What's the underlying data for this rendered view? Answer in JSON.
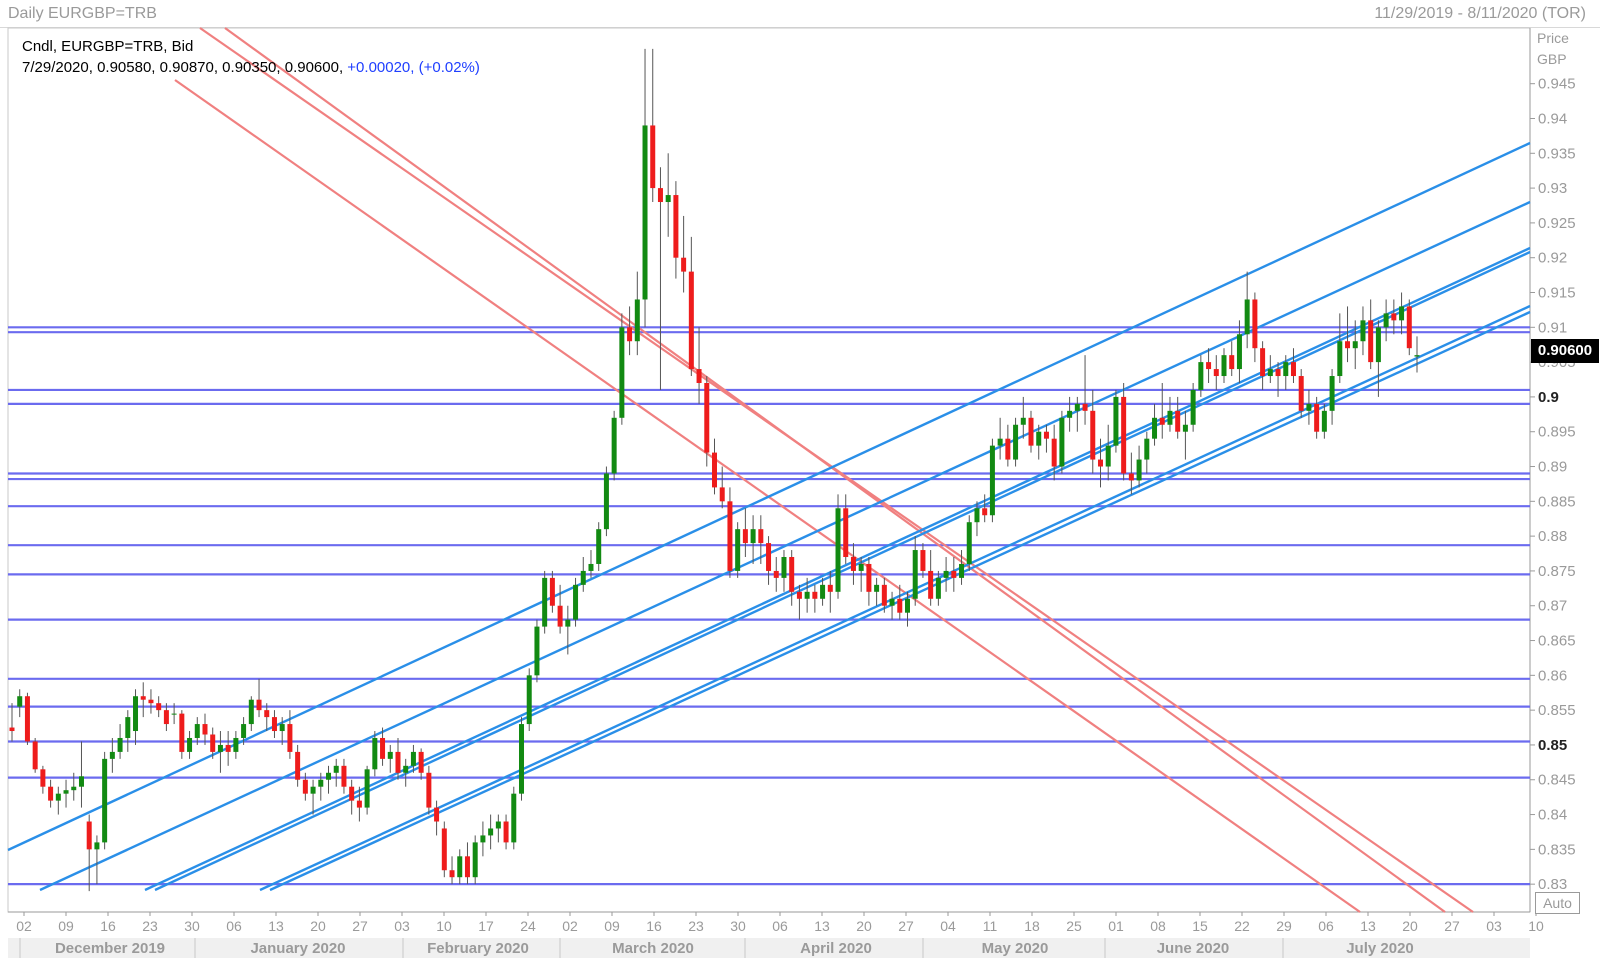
{
  "window": {
    "title": "Daily EURGBP=TRB",
    "date_range": "11/29/2019 - 8/11/2020 (TOR)"
  },
  "info": {
    "line1": "Cndl, EURGBP=TRB, Bid",
    "ohlc": "7/29/2020, 0.90580, 0.90870, 0.90350, 0.90600,",
    "change": "+0.00020, (+0.02%)"
  },
  "axis": {
    "price_label": "Price",
    "currency_label": "GBP",
    "current_price": "0.90600",
    "auto_label": "Auto"
  },
  "colors": {
    "up": "#128a12",
    "down": "#ee1c1c",
    "h_line": "#6b6bef",
    "channel": "#2a8fe8",
    "downtrend": "#f08080",
    "grid": "#b8b8b8"
  },
  "chart_data": {
    "type": "candlestick",
    "symbol": "EURGBP=TRB",
    "ylim": [
      0.826,
      0.953
    ],
    "y_ticks": [
      "0.83",
      "0.835",
      "0.84",
      "0.845",
      "0.85",
      "0.855",
      "0.86",
      "0.865",
      "0.87",
      "0.875",
      "0.88",
      "0.885",
      "0.89",
      "0.895",
      "0.9",
      "0.905",
      "0.91",
      "0.915",
      "0.92",
      "0.925",
      "0.93",
      "0.935",
      "0.94",
      "0.945"
    ],
    "x_ticks": [
      "02",
      "09",
      "16",
      "23",
      "30",
      "06",
      "13",
      "20",
      "27",
      "03",
      "10",
      "17",
      "24",
      "02",
      "09",
      "16",
      "23",
      "30",
      "06",
      "13",
      "20",
      "27",
      "04",
      "11",
      "18",
      "25",
      "01",
      "08",
      "15",
      "22",
      "29",
      "06",
      "13",
      "20",
      "27",
      "03",
      "10"
    ],
    "months": [
      "December 2019",
      "January 2020",
      "February 2020",
      "March 2020",
      "April 2020",
      "May 2020",
      "June 2020",
      "July 2020"
    ],
    "horizontal_levels": [
      0.91,
      0.9093,
      0.901,
      0.899,
      0.889,
      0.8882,
      0.8843,
      0.8787,
      0.8745,
      0.868,
      0.8595,
      0.8555,
      0.8505,
      0.8453,
      0.83
    ],
    "candles": [
      [
        0.8525,
        0.856,
        0.8505,
        0.852
      ],
      [
        0.8555,
        0.858,
        0.854,
        0.857
      ],
      [
        0.857,
        0.8575,
        0.85,
        0.8505
      ],
      [
        0.8505,
        0.851,
        0.846,
        0.8465
      ],
      [
        0.8465,
        0.847,
        0.843,
        0.844
      ],
      [
        0.844,
        0.845,
        0.841,
        0.842
      ],
      [
        0.842,
        0.844,
        0.84,
        0.843
      ],
      [
        0.843,
        0.845,
        0.841,
        0.8435
      ],
      [
        0.8435,
        0.846,
        0.842,
        0.844
      ],
      [
        0.844,
        0.8505,
        0.841,
        0.8455
      ],
      [
        0.839,
        0.84,
        0.829,
        0.835
      ],
      [
        0.835,
        0.837,
        0.83,
        0.836
      ],
      [
        0.836,
        0.849,
        0.835,
        0.848
      ],
      [
        0.848,
        0.851,
        0.846,
        0.849
      ],
      [
        0.849,
        0.853,
        0.848,
        0.851
      ],
      [
        0.851,
        0.855,
        0.849,
        0.854
      ],
      [
        0.852,
        0.858,
        0.85,
        0.857
      ],
      [
        0.857,
        0.859,
        0.854,
        0.8565
      ],
      [
        0.8565,
        0.858,
        0.8545,
        0.856
      ],
      [
        0.856,
        0.857,
        0.854,
        0.855
      ],
      [
        0.855,
        0.856,
        0.852,
        0.853
      ],
      [
        0.8545,
        0.856,
        0.853,
        0.8545
      ],
      [
        0.8545,
        0.855,
        0.848,
        0.849
      ],
      [
        0.849,
        0.852,
        0.848,
        0.851
      ],
      [
        0.851,
        0.854,
        0.85,
        0.853
      ],
      [
        0.853,
        0.8545,
        0.85,
        0.8515
      ],
      [
        0.8515,
        0.8525,
        0.848,
        0.849
      ],
      [
        0.849,
        0.852,
        0.846,
        0.85
      ],
      [
        0.85,
        0.852,
        0.847,
        0.849
      ],
      [
        0.849,
        0.852,
        0.848,
        0.851
      ],
      [
        0.851,
        0.854,
        0.85,
        0.853
      ],
      [
        0.853,
        0.857,
        0.852,
        0.8565
      ],
      [
        0.8565,
        0.8595,
        0.854,
        0.855
      ],
      [
        0.855,
        0.856,
        0.852,
        0.854
      ],
      [
        0.854,
        0.855,
        0.851,
        0.852
      ],
      [
        0.852,
        0.854,
        0.85,
        0.853
      ],
      [
        0.853,
        0.855,
        0.848,
        0.849
      ],
      [
        0.849,
        0.85,
        0.844,
        0.845
      ],
      [
        0.845,
        0.846,
        0.842,
        0.843
      ],
      [
        0.843,
        0.845,
        0.84,
        0.844
      ],
      [
        0.844,
        0.846,
        0.842,
        0.845
      ],
      [
        0.845,
        0.847,
        0.843,
        0.846
      ],
      [
        0.846,
        0.848,
        0.844,
        0.847
      ],
      [
        0.847,
        0.848,
        0.843,
        0.844
      ],
      [
        0.844,
        0.845,
        0.84,
        0.842
      ],
      [
        0.842,
        0.844,
        0.839,
        0.841
      ],
      [
        0.841,
        0.847,
        0.84,
        0.8465
      ],
      [
        0.8465,
        0.852,
        0.8455,
        0.851
      ],
      [
        0.851,
        0.8525,
        0.847,
        0.848
      ],
      [
        0.848,
        0.85,
        0.846,
        0.849
      ],
      [
        0.849,
        0.851,
        0.845,
        0.846
      ],
      [
        0.846,
        0.848,
        0.844,
        0.847
      ],
      [
        0.847,
        0.85,
        0.846,
        0.849
      ],
      [
        0.849,
        0.8495,
        0.845,
        0.846
      ],
      [
        0.846,
        0.847,
        0.84,
        0.841
      ],
      [
        0.841,
        0.842,
        0.837,
        0.839
      ],
      [
        0.838,
        0.839,
        0.831,
        0.832
      ],
      [
        0.832,
        0.834,
        0.83,
        0.831
      ],
      [
        0.831,
        0.835,
        0.83,
        0.834
      ],
      [
        0.834,
        0.836,
        0.83,
        0.831
      ],
      [
        0.831,
        0.837,
        0.83,
        0.836
      ],
      [
        0.836,
        0.839,
        0.834,
        0.837
      ],
      [
        0.837,
        0.84,
        0.835,
        0.838
      ],
      [
        0.838,
        0.84,
        0.836,
        0.839
      ],
      [
        0.839,
        0.84,
        0.835,
        0.836
      ],
      [
        0.836,
        0.844,
        0.835,
        0.843
      ],
      [
        0.843,
        0.854,
        0.842,
        0.853
      ],
      [
        0.853,
        0.861,
        0.852,
        0.86
      ],
      [
        0.86,
        0.868,
        0.859,
        0.867
      ],
      [
        0.867,
        0.875,
        0.866,
        0.874
      ],
      [
        0.874,
        0.875,
        0.869,
        0.87
      ],
      [
        0.87,
        0.873,
        0.866,
        0.867
      ],
      [
        0.867,
        0.87,
        0.863,
        0.868
      ],
      [
        0.868,
        0.874,
        0.867,
        0.873
      ],
      [
        0.873,
        0.877,
        0.872,
        0.875
      ],
      [
        0.875,
        0.878,
        0.874,
        0.876
      ],
      [
        0.876,
        0.882,
        0.875,
        0.881
      ],
      [
        0.881,
        0.89,
        0.88,
        0.889
      ],
      [
        0.889,
        0.898,
        0.888,
        0.897
      ],
      [
        0.897,
        0.912,
        0.896,
        0.91
      ],
      [
        0.91,
        0.913,
        0.906,
        0.908
      ],
      [
        0.908,
        0.918,
        0.906,
        0.914
      ],
      [
        0.914,
        0.95,
        0.91,
        0.939
      ],
      [
        0.939,
        0.95,
        0.928,
        0.93
      ],
      [
        0.93,
        0.933,
        0.901,
        0.928
      ],
      [
        0.928,
        0.935,
        0.923,
        0.929
      ],
      [
        0.929,
        0.931,
        0.917,
        0.92
      ],
      [
        0.92,
        0.926,
        0.915,
        0.918
      ],
      [
        0.918,
        0.923,
        0.903,
        0.904
      ],
      [
        0.904,
        0.91,
        0.899,
        0.902
      ],
      [
        0.902,
        0.903,
        0.89,
        0.892
      ],
      [
        0.892,
        0.894,
        0.886,
        0.887
      ],
      [
        0.887,
        0.89,
        0.884,
        0.885
      ],
      [
        0.885,
        0.887,
        0.874,
        0.875
      ],
      [
        0.875,
        0.882,
        0.874,
        0.881
      ],
      [
        0.881,
        0.884,
        0.877,
        0.879
      ],
      [
        0.879,
        0.883,
        0.876,
        0.881
      ],
      [
        0.881,
        0.883,
        0.876,
        0.879
      ],
      [
        0.879,
        0.88,
        0.873,
        0.875
      ],
      [
        0.875,
        0.877,
        0.872,
        0.874
      ],
      [
        0.874,
        0.878,
        0.872,
        0.877
      ],
      [
        0.877,
        0.878,
        0.87,
        0.872
      ],
      [
        0.872,
        0.873,
        0.868,
        0.871
      ],
      [
        0.871,
        0.874,
        0.869,
        0.872
      ],
      [
        0.872,
        0.873,
        0.869,
        0.871
      ],
      [
        0.871,
        0.874,
        0.87,
        0.873
      ],
      [
        0.873,
        0.875,
        0.869,
        0.872
      ],
      [
        0.872,
        0.886,
        0.871,
        0.884
      ],
      [
        0.884,
        0.886,
        0.876,
        0.877
      ],
      [
        0.877,
        0.879,
        0.873,
        0.875
      ],
      [
        0.875,
        0.877,
        0.872,
        0.876
      ],
      [
        0.876,
        0.877,
        0.87,
        0.872
      ],
      [
        0.872,
        0.874,
        0.87,
        0.873
      ],
      [
        0.873,
        0.874,
        0.869,
        0.87
      ],
      [
        0.87,
        0.872,
        0.868,
        0.871
      ],
      [
        0.871,
        0.873,
        0.868,
        0.869
      ],
      [
        0.869,
        0.872,
        0.867,
        0.871
      ],
      [
        0.871,
        0.88,
        0.87,
        0.878
      ],
      [
        0.878,
        0.879,
        0.874,
        0.875
      ],
      [
        0.875,
        0.878,
        0.87,
        0.871
      ],
      [
        0.871,
        0.875,
        0.87,
        0.874
      ],
      [
        0.874,
        0.877,
        0.872,
        0.875
      ],
      [
        0.875,
        0.877,
        0.872,
        0.874
      ],
      [
        0.874,
        0.878,
        0.873,
        0.876
      ],
      [
        0.876,
        0.883,
        0.875,
        0.882
      ],
      [
        0.882,
        0.885,
        0.88,
        0.884
      ],
      [
        0.884,
        0.886,
        0.882,
        0.883
      ],
      [
        0.883,
        0.894,
        0.882,
        0.893
      ],
      [
        0.893,
        0.897,
        0.891,
        0.894
      ],
      [
        0.894,
        0.896,
        0.89,
        0.891
      ],
      [
        0.891,
        0.897,
        0.89,
        0.896
      ],
      [
        0.896,
        0.9,
        0.894,
        0.897
      ],
      [
        0.897,
        0.898,
        0.892,
        0.893
      ],
      [
        0.893,
        0.896,
        0.891,
        0.895
      ],
      [
        0.895,
        0.896,
        0.892,
        0.894
      ],
      [
        0.894,
        0.896,
        0.888,
        0.89
      ],
      [
        0.89,
        0.898,
        0.889,
        0.897
      ],
      [
        0.897,
        0.9,
        0.895,
        0.898
      ],
      [
        0.898,
        0.9,
        0.895,
        0.899
      ],
      [
        0.899,
        0.906,
        0.896,
        0.898
      ],
      [
        0.898,
        0.901,
        0.889,
        0.891
      ],
      [
        0.891,
        0.894,
        0.887,
        0.89
      ],
      [
        0.89,
        0.896,
        0.888,
        0.893
      ],
      [
        0.893,
        0.901,
        0.892,
        0.9
      ],
      [
        0.9,
        0.902,
        0.888,
        0.889
      ],
      [
        0.889,
        0.892,
        0.886,
        0.888
      ],
      [
        0.888,
        0.893,
        0.887,
        0.891
      ],
      [
        0.891,
        0.895,
        0.889,
        0.894
      ],
      [
        0.894,
        0.899,
        0.893,
        0.897
      ],
      [
        0.897,
        0.902,
        0.894,
        0.896
      ],
      [
        0.896,
        0.9,
        0.895,
        0.898
      ],
      [
        0.898,
        0.9,
        0.894,
        0.895
      ],
      [
        0.895,
        0.898,
        0.891,
        0.896
      ],
      [
        0.896,
        0.902,
        0.895,
        0.901
      ],
      [
        0.901,
        0.906,
        0.9,
        0.905
      ],
      [
        0.905,
        0.907,
        0.902,
        0.904
      ],
      [
        0.904,
        0.906,
        0.901,
        0.903
      ],
      [
        0.903,
        0.907,
        0.902,
        0.906
      ],
      [
        0.906,
        0.908,
        0.903,
        0.904
      ],
      [
        0.904,
        0.911,
        0.902,
        0.909
      ],
      [
        0.909,
        0.918,
        0.907,
        0.914
      ],
      [
        0.914,
        0.915,
        0.905,
        0.907
      ],
      [
        0.907,
        0.908,
        0.901,
        0.903
      ],
      [
        0.903,
        0.906,
        0.902,
        0.904
      ],
      [
        0.904,
        0.905,
        0.9,
        0.903
      ],
      [
        0.903,
        0.906,
        0.901,
        0.905
      ],
      [
        0.905,
        0.907,
        0.902,
        0.903
      ],
      [
        0.903,
        0.904,
        0.897,
        0.898
      ],
      [
        0.898,
        0.901,
        0.896,
        0.899
      ],
      [
        0.899,
        0.9,
        0.894,
        0.895
      ],
      [
        0.895,
        0.899,
        0.894,
        0.898
      ],
      [
        0.898,
        0.904,
        0.896,
        0.903
      ],
      [
        0.903,
        0.912,
        0.902,
        0.908
      ],
      [
        0.908,
        0.913,
        0.905,
        0.907
      ],
      [
        0.907,
        0.911,
        0.904,
        0.908
      ],
      [
        0.908,
        0.913,
        0.906,
        0.911
      ],
      [
        0.911,
        0.914,
        0.904,
        0.905
      ],
      [
        0.905,
        0.911,
        0.9,
        0.91
      ],
      [
        0.91,
        0.914,
        0.908,
        0.912
      ],
      [
        0.912,
        0.914,
        0.909,
        0.911
      ],
      [
        0.911,
        0.915,
        0.909,
        0.913
      ],
      [
        0.913,
        0.914,
        0.906,
        0.907
      ],
      [
        0.9058,
        0.9087,
        0.9035,
        0.906
      ]
    ]
  }
}
